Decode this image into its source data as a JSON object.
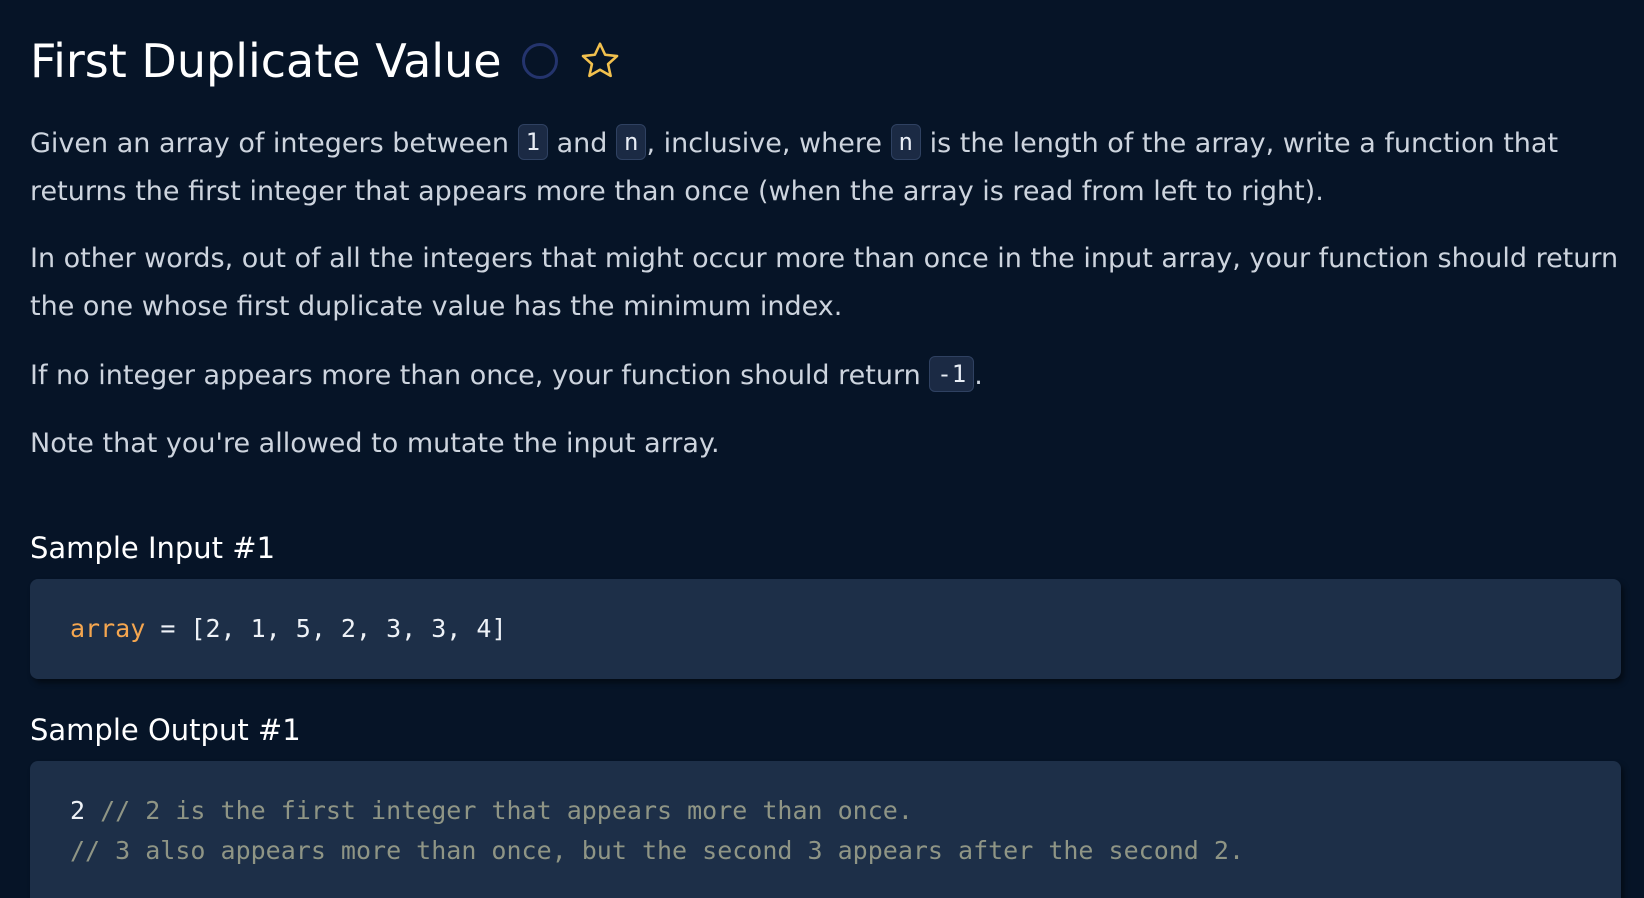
{
  "problem": {
    "title": "First Duplicate Value",
    "paragraph1": {
      "before_1": "Given an array of integers between ",
      "code_1": "1",
      "between": " and ",
      "code_n1": "n",
      "mid": ", inclusive, where ",
      "code_n2": "n",
      "after": " is the length of the array, write a function that returns the first integer that appears more than once (when the array is read from left to right)."
    },
    "paragraph2": "In other words, out of all the integers that might occur more than once in the input array, your function should return the one whose first duplicate value has the minimum index.",
    "paragraph3": {
      "before": "If no integer appears more than once, your function should return ",
      "code": "-1",
      "after": "."
    },
    "paragraph4": "Note that you're allowed to mutate the input array."
  },
  "sample_input": {
    "heading": "Sample Input #1",
    "variable": "array",
    "rest": " = [2, 1, 5, 2, 3, 3, 4]"
  },
  "sample_output": {
    "heading": "Sample Output #1",
    "value": "2",
    "comment_line1": " // 2 is the first integer that appears more than once.",
    "comment_line2": "// 3 also appears more than once, but the second 3 appears after the second 2."
  },
  "colors": {
    "background": "#061427",
    "code_background": "#1d2f48",
    "keyword": "#f5a64f",
    "comment": "#8f9585",
    "star": "#f2c14e",
    "status_ring": "#24346d"
  },
  "icons": {
    "status": "circle-outline-icon",
    "favorite": "star-outline-icon"
  }
}
